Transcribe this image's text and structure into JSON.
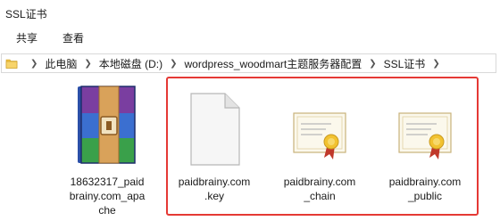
{
  "window": {
    "title": "SSL证书"
  },
  "ribbon": {
    "tabs": [
      "共享",
      "查看"
    ]
  },
  "address": {
    "crumbs": [
      "此电脑",
      "本地磁盘 (D:)",
      "wordpress_woodmart主题服务器配置",
      "SSL证书"
    ]
  },
  "files": [
    {
      "name_lines": [
        "18632317_paid",
        "brainy.com_apa",
        "che"
      ],
      "type_icon": "winrar-archive-icon"
    },
    {
      "name_lines": [
        "paidbrainy.com",
        ".key"
      ],
      "type_icon": "blank-file-icon"
    },
    {
      "name_lines": [
        "paidbrainy.com",
        "_chain"
      ],
      "type_icon": "certificate-icon"
    },
    {
      "name_lines": [
        "paidbrainy.com",
        "_public"
      ],
      "type_icon": "certificate-icon"
    }
  ],
  "colors": {
    "highlight_border": "#e53935"
  }
}
